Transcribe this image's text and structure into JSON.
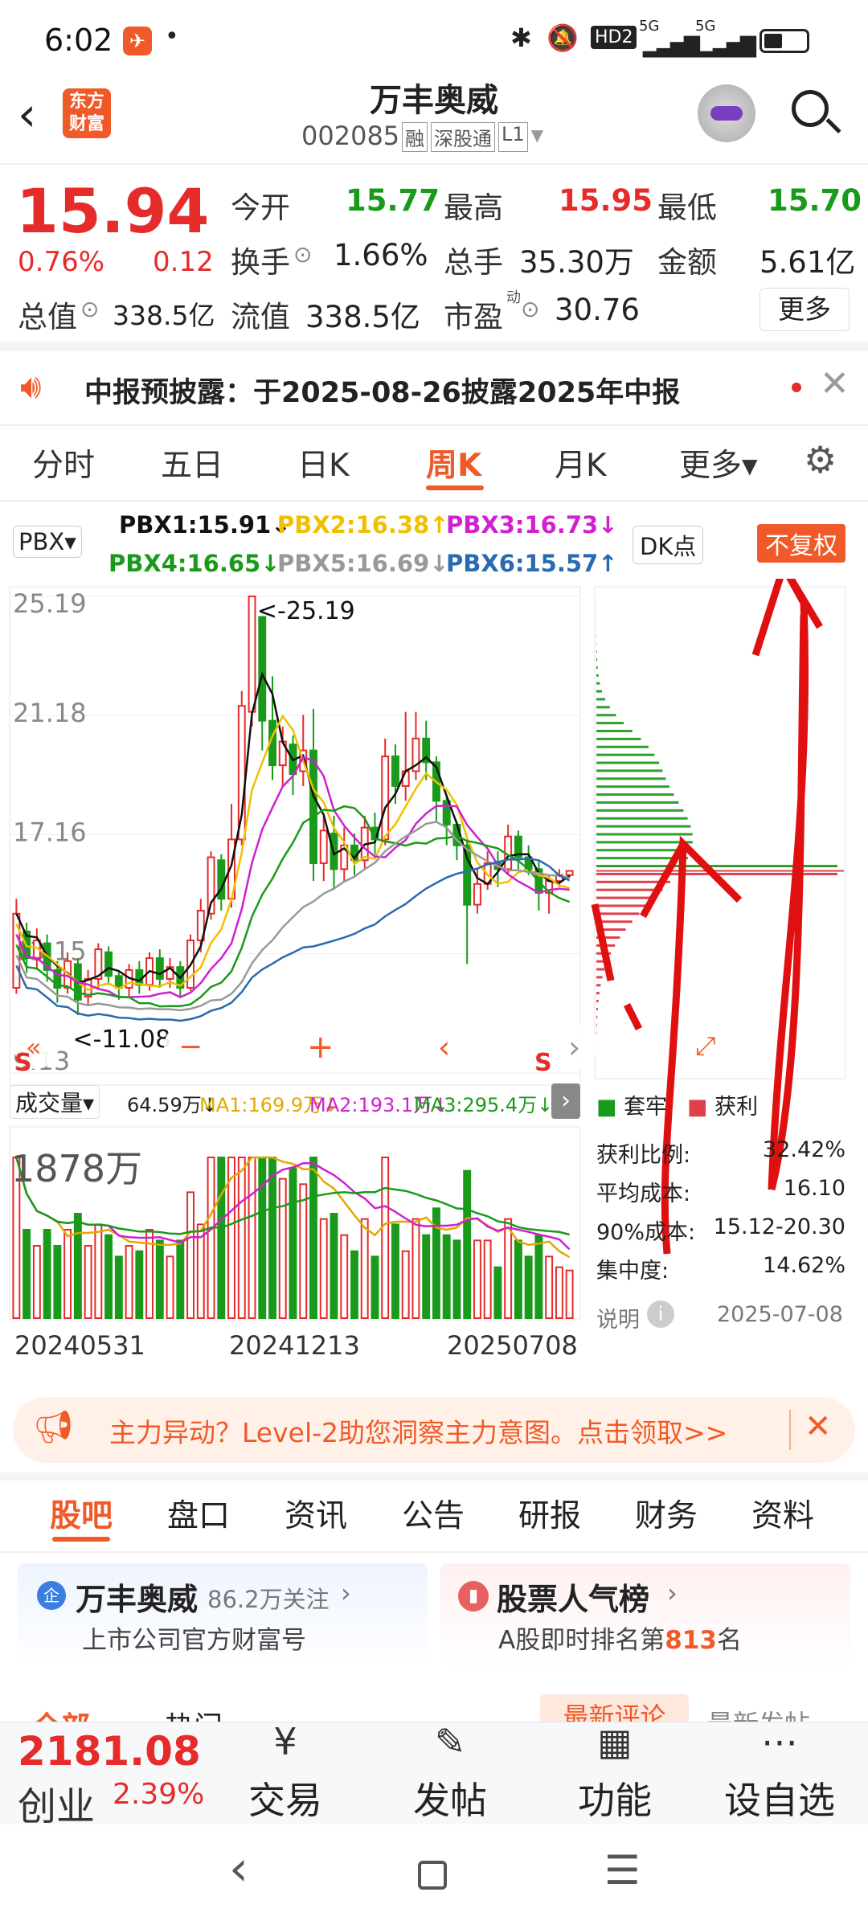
{
  "status": {
    "time": "6:02",
    "network1": "5G",
    "network2": "5G",
    "hd": "HD2"
  },
  "header": {
    "logo": "东方\n财富",
    "title": "万丰奥威",
    "code": "002085",
    "tags": [
      "融",
      "深股通",
      "L1"
    ]
  },
  "quote": {
    "price": "15.94",
    "pct": "0.76%",
    "chg": "0.12",
    "rows": [
      [
        {
          "l": "今开",
          "v": "15.77",
          "c": "green"
        },
        {
          "l": "最高",
          "v": "15.95",
          "c": "red"
        },
        {
          "l": "最低",
          "v": "15.70",
          "c": "green"
        }
      ],
      [
        {
          "l": "换手",
          "v": "1.66%",
          "c": "dark"
        },
        {
          "l": "总手",
          "v": "35.30万",
          "c": "dark"
        },
        {
          "l": "金额",
          "v": "5.61亿",
          "c": "dark"
        }
      ]
    ],
    "total_cap_label": "总值",
    "total_cap": "338.5亿",
    "float_label": "流值",
    "float_cap": "338.5亿",
    "pe_label": "市盈",
    "pe_sup": "动",
    "pe": "30.76",
    "more": "更多"
  },
  "notice": {
    "text": "中报预披露：于2025-08-26披露2025年中报"
  },
  "tabs": [
    "分时",
    "五日",
    "日K",
    "周K",
    "月K",
    "更多▾"
  ],
  "active_tab": "周K",
  "indicator": {
    "name": "PBX▾",
    "dk": "DK点",
    "fq": "不复权",
    "legend": [
      {
        "t": "PBX1:15.91↓",
        "c": "#111"
      },
      {
        "t": "PBX2:16.38↑",
        "c": "#f0c000"
      },
      {
        "t": "PBX3:16.73↓",
        "c": "#d020d0"
      },
      {
        "t": "PBX4:16.65↓",
        "c": "#1a9a1a"
      },
      {
        "t": "PBX5:16.69↓",
        "c": "#999"
      },
      {
        "t": "PBX6:15.57↑",
        "c": "#2a6ab0"
      }
    ]
  },
  "chart_data": {
    "type": "candlestick",
    "yticks": [
      "25.19",
      "21.18",
      "17.16",
      "13.15",
      "9.13"
    ],
    "ylim": [
      9.13,
      25.19
    ],
    "high_label": "<-25.19",
    "low_label": "<-11.08",
    "xticks": [
      "20240531",
      "20241213",
      "20250708"
    ],
    "candles": [
      [
        12,
        14.5,
        11.8,
        15.0
      ],
      [
        13.9,
        13.0,
        12.5,
        14.2
      ],
      [
        13.0,
        13.6,
        12.6,
        14.0
      ],
      [
        13.5,
        12.6,
        12.2,
        13.8
      ],
      [
        12.6,
        12.0,
        11.5,
        12.9
      ],
      [
        12.0,
        12.9,
        11.8,
        13.2
      ],
      [
        12.8,
        11.6,
        11.08,
        13.0
      ],
      [
        11.7,
        12.3,
        11.4,
        12.6
      ],
      [
        12.3,
        13.3,
        12.0,
        13.5
      ],
      [
        13.2,
        12.4,
        12.1,
        13.4
      ],
      [
        12.4,
        12.0,
        11.6,
        12.6
      ],
      [
        12.0,
        12.6,
        11.7,
        12.8
      ],
      [
        12.6,
        12.1,
        11.8,
        12.9
      ],
      [
        12.1,
        13.0,
        11.9,
        13.2
      ],
      [
        13.0,
        12.3,
        12.0,
        13.3
      ],
      [
        12.3,
        12.7,
        12.0,
        13.0
      ],
      [
        12.7,
        12.0,
        11.7,
        12.9
      ],
      [
        12.0,
        13.6,
        11.9,
        13.8
      ],
      [
        13.6,
        14.6,
        13.2,
        15.0
      ],
      [
        14.5,
        16.4,
        14.3,
        16.6
      ],
      [
        16.3,
        15.0,
        14.6,
        16.5
      ],
      [
        15.0,
        17.0,
        14.7,
        18.2
      ],
      [
        17.0,
        21.5,
        16.8,
        22.0
      ],
      [
        21.3,
        25.19,
        20.8,
        25.19
      ],
      [
        24.5,
        21.0,
        20.0,
        24.0
      ],
      [
        21.0,
        19.5,
        19.0,
        22.5
      ],
      [
        19.5,
        20.3,
        18.8,
        20.8
      ],
      [
        20.2,
        19.2,
        18.5,
        20.5
      ],
      [
        19.3,
        20.0,
        18.8,
        21.2
      ],
      [
        20.0,
        16.2,
        15.6,
        21.4
      ],
      [
        16.2,
        17.3,
        15.6,
        17.8
      ],
      [
        17.2,
        16.0,
        15.3,
        17.8
      ],
      [
        16.0,
        16.8,
        15.6,
        17.4
      ],
      [
        16.8,
        16.3,
        15.8,
        17.2
      ],
      [
        16.3,
        17.4,
        16.0,
        17.8
      ],
      [
        17.4,
        17.0,
        16.5,
        17.9
      ],
      [
        17.0,
        19.8,
        16.8,
        20.4
      ],
      [
        19.8,
        18.8,
        18.2,
        20.2
      ],
      [
        18.8,
        19.3,
        18.3,
        21.3
      ],
      [
        19.3,
        20.4,
        19.0,
        21.3
      ],
      [
        20.4,
        19.6,
        19.0,
        21.0
      ],
      [
        19.6,
        18.3,
        17.6,
        19.8
      ],
      [
        18.3,
        17.5,
        16.8,
        18.5
      ],
      [
        17.5,
        16.8,
        16.3,
        17.6
      ],
      [
        16.8,
        14.8,
        12.8,
        17.0
      ],
      [
        14.8,
        15.5,
        14.5,
        16.0
      ],
      [
        15.5,
        16.2,
        15.3,
        16.6
      ],
      [
        16.2,
        16.0,
        15.4,
        16.6
      ],
      [
        16.0,
        17.1,
        15.8,
        17.5
      ],
      [
        17.1,
        16.4,
        16.0,
        17.3
      ],
      [
        16.4,
        16.0,
        15.8,
        16.8
      ],
      [
        16.0,
        15.2,
        14.6,
        16.3
      ],
      [
        15.2,
        15.6,
        14.5,
        15.8
      ],
      [
        15.6,
        15.8,
        15.4,
        16.0
      ],
      [
        15.8,
        15.94,
        15.7,
        15.95
      ]
    ]
  },
  "chips": {
    "title": "套牢",
    "profit": "获利"
  },
  "stats": [
    {
      "l": "获利比例:",
      "v": "32.42%"
    },
    {
      "l": "平均成本:",
      "v": "16.10"
    },
    {
      "l": "90%成本:",
      "v": "15.12-20.30"
    },
    {
      "l": "集中度:",
      "v": "14.62%"
    }
  ],
  "stats_note": "说明",
  "stats_date": "2025-07-08",
  "volume": {
    "label": "成交量▾",
    "v": "64.59万↓",
    "ma1": "MA1:169.9万↓",
    "ma2": "MA2:193.1万↓",
    "ma3": "MA3:295.4万↓",
    "max": "1878万"
  },
  "banner": {
    "text": "主力异动？Level-2助您洞察主力意图。点击领取>>"
  },
  "section_tabs": [
    "股吧",
    "盘口",
    "资讯",
    "公告",
    "研报",
    "财务",
    "资料"
  ],
  "cards": [
    {
      "name": "万丰奥威",
      "sub": "86.2万关注",
      "desc": "上市公司官方财富号"
    },
    {
      "name": "股票人气榜",
      "desc_pre": "A股即时排名第",
      "rank": "813",
      "desc_post": "名"
    }
  ],
  "subtabs": [
    "全部",
    "热门",
    "最新评论",
    "最新发帖"
  ],
  "index": {
    "value": "2181.08",
    "name": "创业",
    "pct": "2.39%"
  },
  "bottom_nav": [
    {
      "icon": "¥",
      "label": "交易"
    },
    {
      "icon": "✎",
      "label": "发帖"
    },
    {
      "icon": "▦",
      "label": "功能"
    },
    {
      "icon": "⋯",
      "label": "设自选"
    }
  ]
}
